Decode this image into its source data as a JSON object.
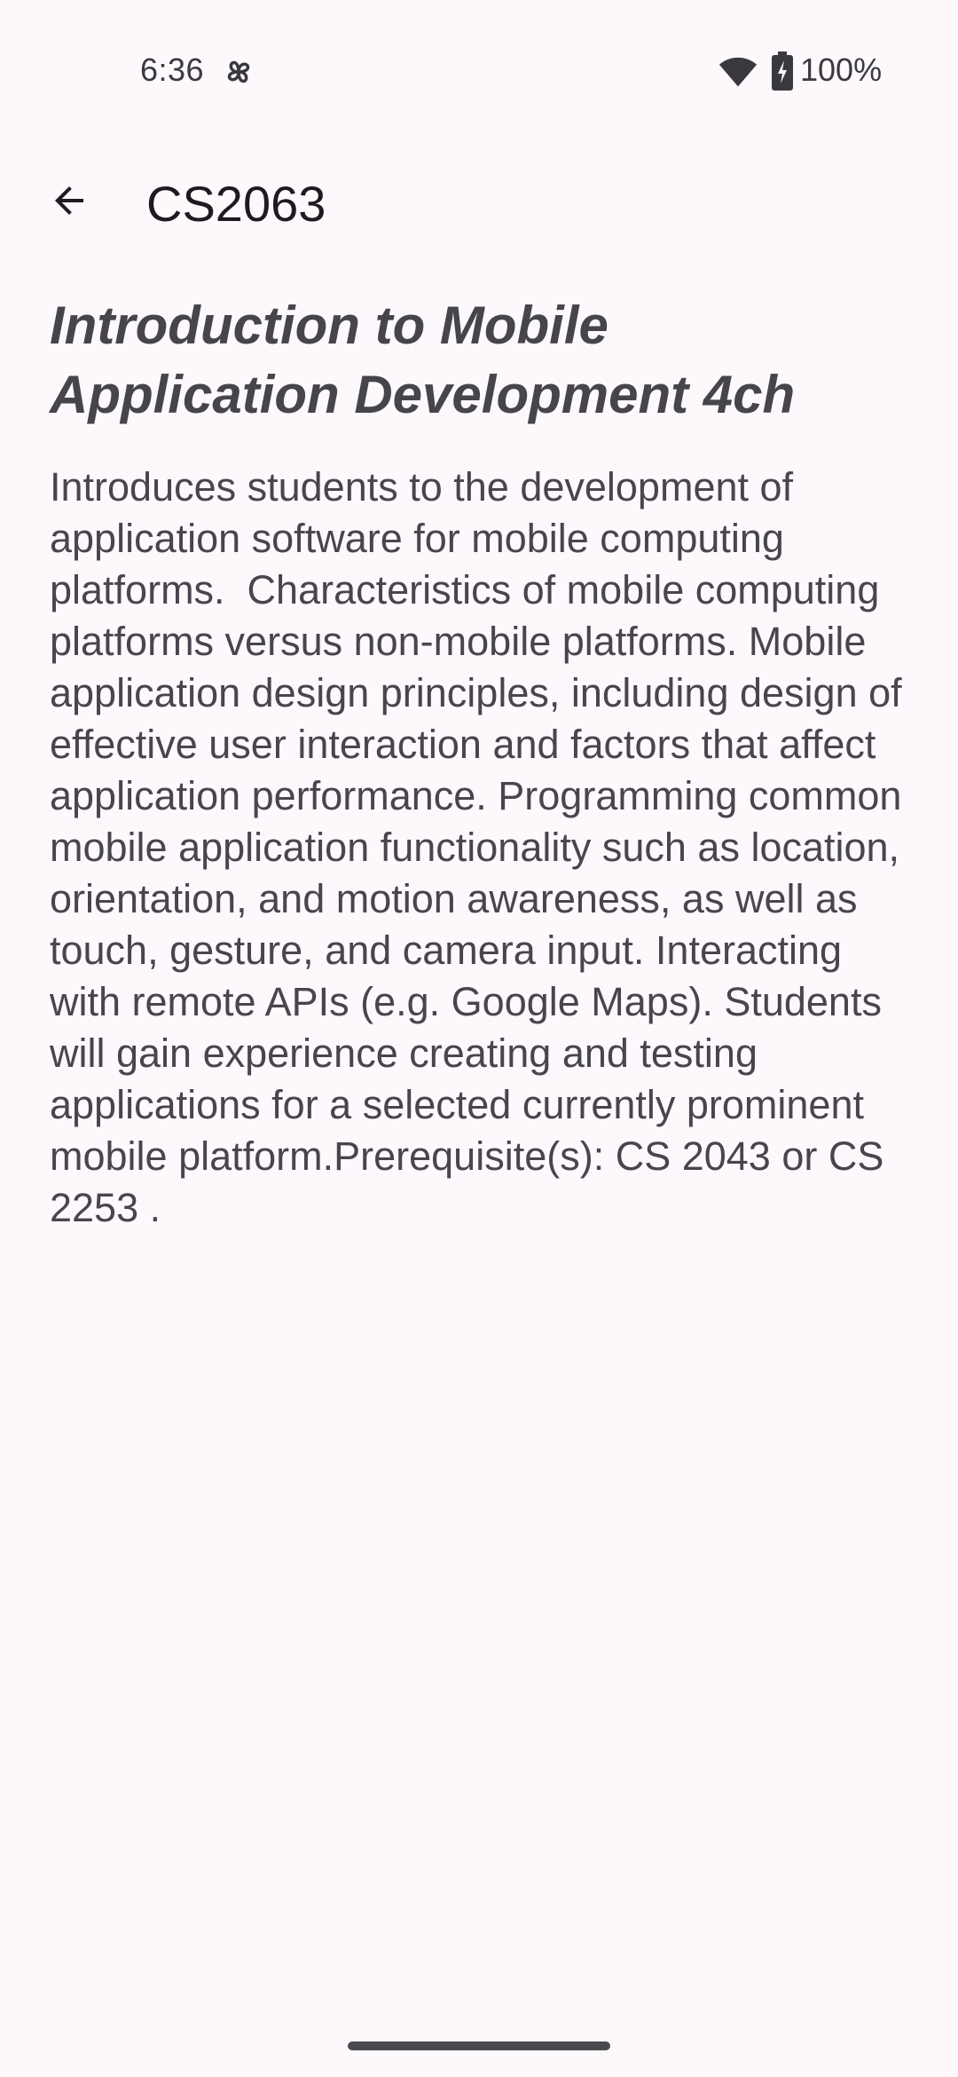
{
  "status_bar": {
    "time": "6:36",
    "battery": "100%",
    "app_icon": "pinwheel-icon",
    "wifi_icon": "wifi-icon",
    "battery_icon": "battery-charging-icon"
  },
  "app_bar": {
    "back_icon": "arrow-back-icon",
    "title": "CS2063"
  },
  "course": {
    "title": "Introduction to Mobile Application Development 4ch",
    "description": "Introduces students to the development of application software for mobile computing platforms.  Characteristics of mobile computing platforms versus non-mobile platforms. Mobile application design principles, including design of effective user interaction and factors that affect application performance. Programming common mobile application functionality such as location, orientation, and motion awareness, as well as touch, gesture, and camera input. Interacting with remote APIs (e.g. Google Maps). Students will gain experience creating and testing applications for a selected currently prominent mobile platform.Prerequisite(s): CS 2043 or CS 2253 ."
  },
  "colors": {
    "background": "#fdf8fc",
    "title_text": "#46454a",
    "body_text": "#49454f"
  }
}
